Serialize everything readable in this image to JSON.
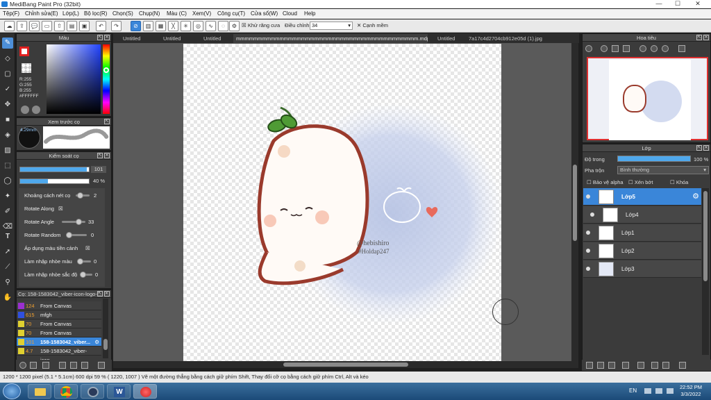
{
  "app": {
    "title": "MediBang Paint Pro (32bit)"
  },
  "menu": [
    "Tệp(F)",
    "Chỉnh sửa(E)",
    "Lớp(L)",
    "Bộ lọc(R)",
    "Chọn(S)",
    "Chụp(N)",
    "Màu (C)",
    "Xem(V)",
    "Công cụ(T)",
    "Cửa sổ(W)",
    "Cloud",
    "Help"
  ],
  "toolbar": {
    "antialias_label": "Khử răng cưa",
    "correction_label": "Điều chỉnh",
    "correction_value": "34",
    "soft_edge_label": "Cạnh mềm"
  },
  "color_panel": {
    "title": "Màu",
    "r": "R:255",
    "g": "G:255",
    "b": "B:255",
    "hex": "#FFFFFF",
    "accent": "#e02020"
  },
  "brush_preview": {
    "title": "Xem trước cọ",
    "size": "4.29mm"
  },
  "brush_control": {
    "title": "Kiểm soát cọ",
    "size_value": "101",
    "opacity_value": "40 %",
    "rows": [
      {
        "label": "Khoảng cách nét cọ",
        "value": "2"
      },
      {
        "label": "Rotate Along",
        "value": "☒"
      },
      {
        "label": "Rotate Angle",
        "value": "33"
      },
      {
        "label": "Rotate Random",
        "value": "0"
      },
      {
        "label": "Áp dụng màu tiền cảnh",
        "value": "☒"
      },
      {
        "label": "Làm nhập nhòe màu",
        "value": "0"
      },
      {
        "label": "Làm nhập nhòe sắc độ",
        "value": "0"
      }
    ]
  },
  "brush_list": {
    "title": "Cọ: 158-1583042_viber-icon-logo-...",
    "items": [
      {
        "size": "124",
        "name": "From Canvas",
        "color": "#9b30d0"
      },
      {
        "size": "615",
        "name": "mfgh",
        "color": "#3050e0"
      },
      {
        "size": "70",
        "name": "From Canvas",
        "color": "#e0d030"
      },
      {
        "size": "70",
        "name": "From Canvas",
        "color": "#e0d030"
      },
      {
        "size": "101",
        "name": "158-1583042_viber...",
        "color": "#e0d030"
      },
      {
        "size": "4.7",
        "name": "158-1583042_viber-icon-...",
        "color": "#e0d030"
      }
    ]
  },
  "tabs": [
    "Untitled",
    "Untitled",
    "Untitled",
    "mmmmmmmmmmmmmmmmmmmmmmmmmmmmmmmmmmmmmmmmmm.mdp",
    "Untitled",
    "7a17c4d2704cb912e05d (1).jpg"
  ],
  "canvas": {
    "signature": "@hebishiro",
    "tag": "#Holdap247"
  },
  "navigator": {
    "title": "Hoa tiêu"
  },
  "layers": {
    "title": "Lớp",
    "opacity_label": "Độ trong",
    "opacity_value": "100 %",
    "blend_label": "Pha trộn",
    "blend_value": "Bình thường",
    "protect_alpha": "Bảo vệ alpha",
    "clipping": "Xén bớt",
    "lock": "Khóa",
    "items": [
      {
        "name": "Lớp5",
        "selected": true
      },
      {
        "name": "Lớp4",
        "selected": false
      },
      {
        "name": "Lớp1",
        "selected": false
      },
      {
        "name": "Lớp2",
        "selected": false
      },
      {
        "name": "Lớp3",
        "selected": false
      }
    ]
  },
  "status": {
    "text": "1200 * 1200 pixel   (5.1 * 5.1cm)   600 dpi   59 %   ( 1220, 1007 )   Vẽ một đường thẳng bằng cách giữ phím Shift, Thay đổi cỡ cọ bằng cách giữ phím Ctrl, Alt và kéo"
  },
  "taskbar": {
    "lang": "EN",
    "time": "22:52 PM",
    "date": "3/3/2022"
  }
}
